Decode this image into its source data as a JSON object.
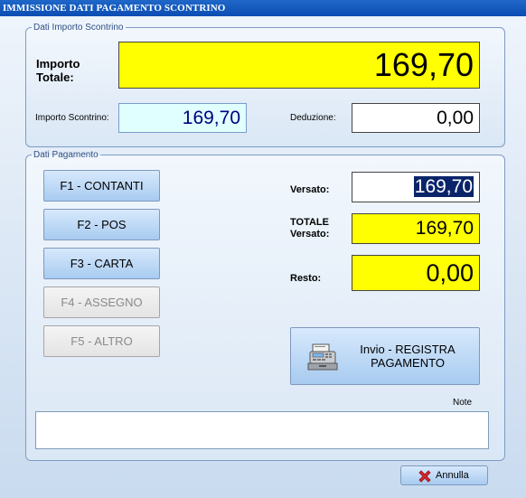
{
  "window": {
    "title": "IMMISSIONE DATI PAGAMENTO SCONTRINO"
  },
  "importo_group": {
    "legend": "Dati Importo Scontrino",
    "importo_totale_label": "Importo\nTotale:",
    "importo_totale_value": "169,70",
    "importo_scontrino_label": "Importo Scontrino:",
    "importo_scontrino_value": "169,70",
    "deduzione_label": "Deduzione:",
    "deduzione_value": "0,00"
  },
  "pagamento_group": {
    "legend": "Dati Pagamento",
    "buttons": [
      {
        "label": "F1 - CONTANTI",
        "enabled": true
      },
      {
        "label": "F2 - POS",
        "enabled": true
      },
      {
        "label": "F3 - CARTA",
        "enabled": true
      },
      {
        "label": "F4 - ASSEGNO",
        "enabled": false
      },
      {
        "label": "F5 - ALTRO",
        "enabled": false
      }
    ],
    "versato_label": "Versato:",
    "versato_value": "169,70",
    "totale_versato_label": "TOTALE\nVersato:",
    "totale_versato_value": "169,70",
    "resto_label": "Resto:",
    "resto_value": "0,00",
    "registra_button_label": "Invio - REGISTRA\nPAGAMENTO",
    "note_label": "Note",
    "note_value": ""
  },
  "footer": {
    "annulla_label": "Annulla"
  },
  "colors": {
    "highlight_yellow": "#ffff00",
    "scontrino_bg": "#e0ffff",
    "scontrino_text": "#000080",
    "selection": "#0a246a",
    "cancel_icon_red": "#d9262a"
  },
  "icons": [
    "cash-register-icon",
    "cancel-x-icon"
  ]
}
